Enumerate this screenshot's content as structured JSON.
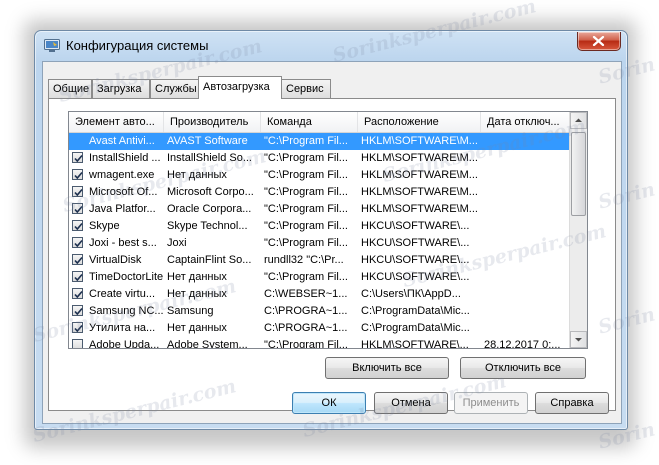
{
  "window": {
    "title": "Конфигурация системы"
  },
  "tabs": [
    {
      "label": "Общие",
      "active": false
    },
    {
      "label": "Загрузка",
      "active": false
    },
    {
      "label": "Службы",
      "active": false
    },
    {
      "label": "Автозагрузка",
      "active": true
    },
    {
      "label": "Сервис",
      "active": false
    }
  ],
  "startup_list": {
    "columns": [
      "Элемент авто...",
      "Производитель",
      "Команда",
      "Расположение",
      "Дата отключ..."
    ],
    "rows": [
      {
        "checked": true,
        "cells": [
          "Avast Antivi...",
          "AVAST Software",
          "\"C:\\Program Fil...",
          "HKLM\\SOFTWARE\\M...",
          ""
        ],
        "selected": true
      },
      {
        "checked": true,
        "cells": [
          "InstallShield ...",
          "InstallShield So...",
          "\"C:\\Program Fil...",
          "HKLM\\SOFTWARE\\M...",
          ""
        ]
      },
      {
        "checked": true,
        "cells": [
          "wmagent.exe",
          "Нет данных",
          "\"C:\\Program Fil...",
          "HKLM\\SOFTWARE\\M...",
          ""
        ]
      },
      {
        "checked": true,
        "cells": [
          "Microsoft Of...",
          "Microsoft Corpo...",
          "\"C:\\Program Fil...",
          "HKLM\\SOFTWARE\\M...",
          ""
        ]
      },
      {
        "checked": true,
        "cells": [
          "Java Platfor...",
          "Oracle Corpora...",
          "\"C:\\Program Fil...",
          "HKLM\\SOFTWARE\\M...",
          ""
        ]
      },
      {
        "checked": true,
        "cells": [
          "Skype",
          "Skype Technol...",
          "\"C:\\Program Fil...",
          "HKCU\\SOFTWARE\\...",
          ""
        ]
      },
      {
        "checked": true,
        "cells": [
          "Joxi - best s...",
          "Joxi",
          "\"C:\\Program Fil...",
          "HKCU\\SOFTWARE\\...",
          ""
        ]
      },
      {
        "checked": true,
        "cells": [
          "VirtualDisk",
          "CaptainFlint So...",
          "rundll32 \"C:\\Pr...",
          "HKCU\\SOFTWARE\\...",
          ""
        ]
      },
      {
        "checked": true,
        "cells": [
          "TimeDoctorLite",
          "Нет данных",
          "\"C:\\Program Fil...",
          "HKCU\\SOFTWARE\\...",
          ""
        ]
      },
      {
        "checked": true,
        "cells": [
          "Create virtu...",
          "Нет данных",
          "C:\\WEBSER~1...",
          "C:\\Users\\ПК\\AppD...",
          ""
        ]
      },
      {
        "checked": true,
        "cells": [
          "Samsung NC...",
          "Samsung",
          "C:\\PROGRA~1...",
          "C:\\ProgramData\\Mic...",
          ""
        ]
      },
      {
        "checked": true,
        "cells": [
          "Утилита на...",
          "Нет данных",
          "C:\\PROGRA~1...",
          "C:\\ProgramData\\Mic...",
          ""
        ]
      },
      {
        "checked": false,
        "cells": [
          "Adobe Upda...",
          "Adobe System...",
          "\"C:\\Program Fil...",
          "HKLM\\SOFTWARE\\...",
          "28.12.2017 0:..."
        ]
      }
    ]
  },
  "buttons": {
    "enable_all": "Включить все",
    "disable_all": "Отключить все",
    "ok": "ОК",
    "cancel": "Отмена",
    "apply": "Применить",
    "help": "Справка"
  },
  "watermark": {
    "text": "Sorinksperpair.com",
    "short": "Sorin"
  },
  "colors": {
    "selection": "#3399ff",
    "close_button": "#c7442b",
    "window_frame": "#bcd5ee"
  }
}
